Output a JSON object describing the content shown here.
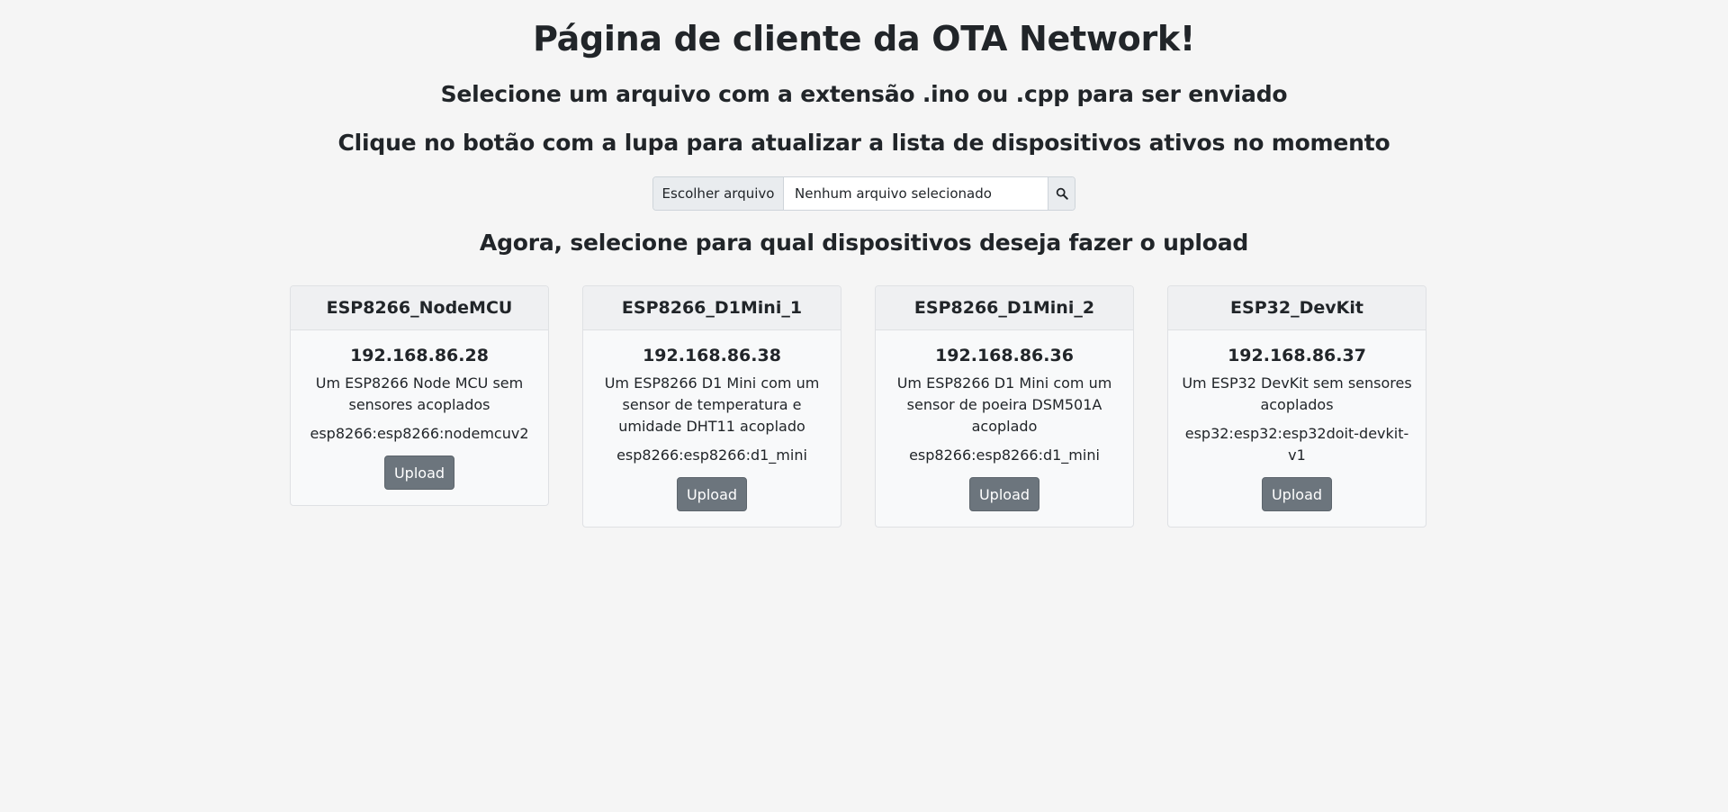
{
  "header": {
    "title": "Página de cliente da OTA Network!",
    "subtitle_1": "Selecione um arquivo com a extensão .ino ou .cpp para ser enviado",
    "subtitle_2": "Clique no botão com a lupa para atualizar a lista de dispositivos ativos no momento",
    "subtitle_3": "Agora, selecione para qual dispositivos deseja fazer o upload"
  },
  "file_input": {
    "button_label": "Escolher arquivo",
    "status": "Nenhum arquivo selecionado",
    "search_icon": "search-icon"
  },
  "devices": [
    {
      "name": "ESP8266_NodeMCU",
      "ip": "192.168.86.28",
      "description": "Um ESP8266 Node MCU sem sensores acoplados",
      "board": "esp8266:esp8266:nodemcuv2",
      "button": "Upload"
    },
    {
      "name": "ESP8266_D1Mini_1",
      "ip": "192.168.86.38",
      "description": "Um ESP8266 D1 Mini com um sensor de temperatura e umidade DHT11 acoplado",
      "board": "esp8266:esp8266:d1_mini",
      "button": "Upload"
    },
    {
      "name": "ESP8266_D1Mini_2",
      "ip": "192.168.86.36",
      "description": "Um ESP8266 D1 Mini com um sensor de poeira DSM501A acoplado",
      "board": "esp8266:esp8266:d1_mini",
      "button": "Upload"
    },
    {
      "name": "ESP32_DevKit",
      "ip": "192.168.86.37",
      "description": "Um ESP32 DevKit sem sensores acoplados",
      "board": "esp32:esp32:esp32doit-devkit-v1",
      "button": "Upload"
    }
  ],
  "colors": {
    "background": "#f5f5f5",
    "text": "#212529",
    "card_header": "#eff0f2",
    "card_body": "#f8f9fa",
    "button": "#6c757d"
  }
}
